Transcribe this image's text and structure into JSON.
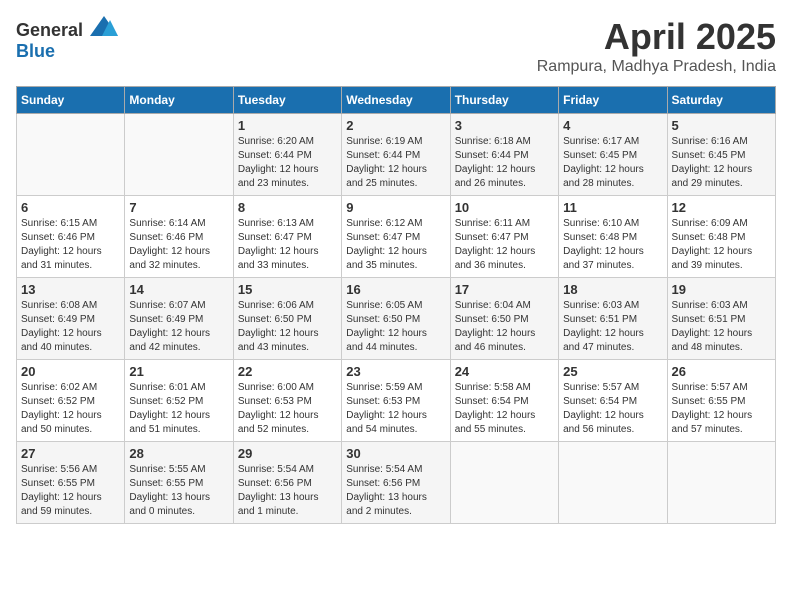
{
  "header": {
    "logo_general": "General",
    "logo_blue": "Blue",
    "title": "April 2025",
    "subtitle": "Rampura, Madhya Pradesh, India"
  },
  "days_of_week": [
    "Sunday",
    "Monday",
    "Tuesday",
    "Wednesday",
    "Thursday",
    "Friday",
    "Saturday"
  ],
  "weeks": [
    [
      {
        "day": "",
        "info": ""
      },
      {
        "day": "",
        "info": ""
      },
      {
        "day": "1",
        "info": "Sunrise: 6:20 AM\nSunset: 6:44 PM\nDaylight: 12 hours\nand 23 minutes."
      },
      {
        "day": "2",
        "info": "Sunrise: 6:19 AM\nSunset: 6:44 PM\nDaylight: 12 hours\nand 25 minutes."
      },
      {
        "day": "3",
        "info": "Sunrise: 6:18 AM\nSunset: 6:44 PM\nDaylight: 12 hours\nand 26 minutes."
      },
      {
        "day": "4",
        "info": "Sunrise: 6:17 AM\nSunset: 6:45 PM\nDaylight: 12 hours\nand 28 minutes."
      },
      {
        "day": "5",
        "info": "Sunrise: 6:16 AM\nSunset: 6:45 PM\nDaylight: 12 hours\nand 29 minutes."
      }
    ],
    [
      {
        "day": "6",
        "info": "Sunrise: 6:15 AM\nSunset: 6:46 PM\nDaylight: 12 hours\nand 31 minutes."
      },
      {
        "day": "7",
        "info": "Sunrise: 6:14 AM\nSunset: 6:46 PM\nDaylight: 12 hours\nand 32 minutes."
      },
      {
        "day": "8",
        "info": "Sunrise: 6:13 AM\nSunset: 6:47 PM\nDaylight: 12 hours\nand 33 minutes."
      },
      {
        "day": "9",
        "info": "Sunrise: 6:12 AM\nSunset: 6:47 PM\nDaylight: 12 hours\nand 35 minutes."
      },
      {
        "day": "10",
        "info": "Sunrise: 6:11 AM\nSunset: 6:47 PM\nDaylight: 12 hours\nand 36 minutes."
      },
      {
        "day": "11",
        "info": "Sunrise: 6:10 AM\nSunset: 6:48 PM\nDaylight: 12 hours\nand 37 minutes."
      },
      {
        "day": "12",
        "info": "Sunrise: 6:09 AM\nSunset: 6:48 PM\nDaylight: 12 hours\nand 39 minutes."
      }
    ],
    [
      {
        "day": "13",
        "info": "Sunrise: 6:08 AM\nSunset: 6:49 PM\nDaylight: 12 hours\nand 40 minutes."
      },
      {
        "day": "14",
        "info": "Sunrise: 6:07 AM\nSunset: 6:49 PM\nDaylight: 12 hours\nand 42 minutes."
      },
      {
        "day": "15",
        "info": "Sunrise: 6:06 AM\nSunset: 6:50 PM\nDaylight: 12 hours\nand 43 minutes."
      },
      {
        "day": "16",
        "info": "Sunrise: 6:05 AM\nSunset: 6:50 PM\nDaylight: 12 hours\nand 44 minutes."
      },
      {
        "day": "17",
        "info": "Sunrise: 6:04 AM\nSunset: 6:50 PM\nDaylight: 12 hours\nand 46 minutes."
      },
      {
        "day": "18",
        "info": "Sunrise: 6:03 AM\nSunset: 6:51 PM\nDaylight: 12 hours\nand 47 minutes."
      },
      {
        "day": "19",
        "info": "Sunrise: 6:03 AM\nSunset: 6:51 PM\nDaylight: 12 hours\nand 48 minutes."
      }
    ],
    [
      {
        "day": "20",
        "info": "Sunrise: 6:02 AM\nSunset: 6:52 PM\nDaylight: 12 hours\nand 50 minutes."
      },
      {
        "day": "21",
        "info": "Sunrise: 6:01 AM\nSunset: 6:52 PM\nDaylight: 12 hours\nand 51 minutes."
      },
      {
        "day": "22",
        "info": "Sunrise: 6:00 AM\nSunset: 6:53 PM\nDaylight: 12 hours\nand 52 minutes."
      },
      {
        "day": "23",
        "info": "Sunrise: 5:59 AM\nSunset: 6:53 PM\nDaylight: 12 hours\nand 54 minutes."
      },
      {
        "day": "24",
        "info": "Sunrise: 5:58 AM\nSunset: 6:54 PM\nDaylight: 12 hours\nand 55 minutes."
      },
      {
        "day": "25",
        "info": "Sunrise: 5:57 AM\nSunset: 6:54 PM\nDaylight: 12 hours\nand 56 minutes."
      },
      {
        "day": "26",
        "info": "Sunrise: 5:57 AM\nSunset: 6:55 PM\nDaylight: 12 hours\nand 57 minutes."
      }
    ],
    [
      {
        "day": "27",
        "info": "Sunrise: 5:56 AM\nSunset: 6:55 PM\nDaylight: 12 hours\nand 59 minutes."
      },
      {
        "day": "28",
        "info": "Sunrise: 5:55 AM\nSunset: 6:55 PM\nDaylight: 13 hours\nand 0 minutes."
      },
      {
        "day": "29",
        "info": "Sunrise: 5:54 AM\nSunset: 6:56 PM\nDaylight: 13 hours\nand 1 minute."
      },
      {
        "day": "30",
        "info": "Sunrise: 5:54 AM\nSunset: 6:56 PM\nDaylight: 13 hours\nand 2 minutes."
      },
      {
        "day": "",
        "info": ""
      },
      {
        "day": "",
        "info": ""
      },
      {
        "day": "",
        "info": ""
      }
    ]
  ]
}
